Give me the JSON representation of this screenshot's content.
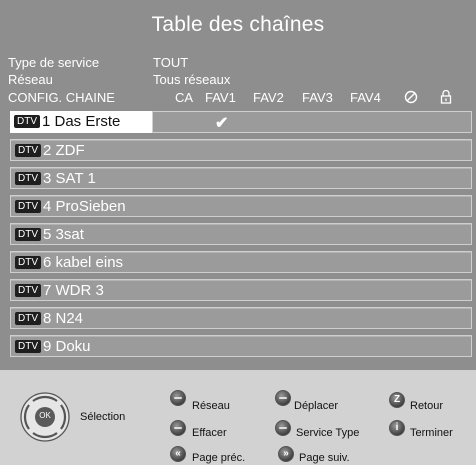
{
  "title": "Table des chaînes",
  "service": {
    "label": "Type de service",
    "value": "TOUT"
  },
  "network": {
    "label": "Réseau",
    "value": "Tous réseaux"
  },
  "columns": {
    "config": "CONFIG. CHAINE",
    "ca": "CA",
    "fav1": "FAV1",
    "fav2": "FAV2",
    "fav3": "FAV3",
    "fav4": "FAV4",
    "skip_icon": "no-entry-icon",
    "lock_icon": "lock-icon"
  },
  "badge": "DTV",
  "check_mark": "✔",
  "channels": [
    {
      "name": "1 Das Erste",
      "fav1": true,
      "selected": true
    },
    {
      "name": "2 ZDF"
    },
    {
      "name": "3 SAT 1"
    },
    {
      "name": "4 ProSieben"
    },
    {
      "name": "5 3sat"
    },
    {
      "name": "6 kabel eins"
    },
    {
      "name": "7 WDR 3"
    },
    {
      "name": "8 N24"
    },
    {
      "name": "9 Doku"
    }
  ],
  "legend": {
    "selection": "Sélection",
    "ok": "OK",
    "reseau": "Réseau",
    "deplacer": "Déplacer",
    "retour": "Retour",
    "effacer": "Effacer",
    "service_type": "Service Type",
    "terminer": "Terminer",
    "page_prec": "Page préc.",
    "page_suiv": "Page suiv.",
    "retour_key": "Z",
    "terminer_key": "i",
    "prev_key": "«",
    "next_key": "»"
  }
}
